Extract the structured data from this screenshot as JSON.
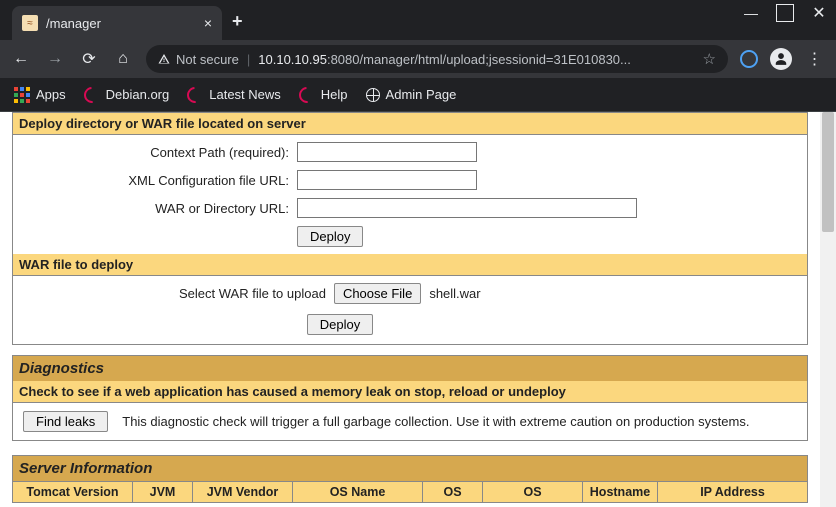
{
  "window": {
    "tab_title": "/manager",
    "url_host": "10.10.10.95",
    "url_port": ":8080",
    "url_path": "/manager/html/upload;jsessionid=31E010830...",
    "not_secure": "Not secure"
  },
  "bookmarks": {
    "apps": "Apps",
    "debian": "Debian.org",
    "latest": "Latest News",
    "help": "Help",
    "admin": "Admin Page"
  },
  "deploy1": {
    "header": "Deploy directory or WAR file located on server",
    "context_label": "Context Path (required):",
    "xml_label": "XML Configuration file URL:",
    "war_label": "WAR or Directory URL:",
    "deploy_btn": "Deploy",
    "context_val": "",
    "xml_val": "",
    "war_val": ""
  },
  "deploy2": {
    "header": "WAR file to deploy",
    "select_label": "Select WAR file to upload",
    "choose_file": "Choose File",
    "filename": "shell.war",
    "deploy_btn": "Deploy"
  },
  "diagnostics": {
    "title": "Diagnostics",
    "subheader": "Check to see if a web application has caused a memory leak on stop, reload or undeploy",
    "find_leaks": "Find leaks",
    "desc": "This diagnostic check will trigger a full garbage collection. Use it with extreme caution on production systems."
  },
  "server": {
    "title": "Server Information",
    "cols": [
      "Tomcat Version",
      "JVM",
      "JVM Vendor",
      "OS Name",
      "OS",
      "OS",
      "Hostname",
      "IP Address"
    ]
  }
}
